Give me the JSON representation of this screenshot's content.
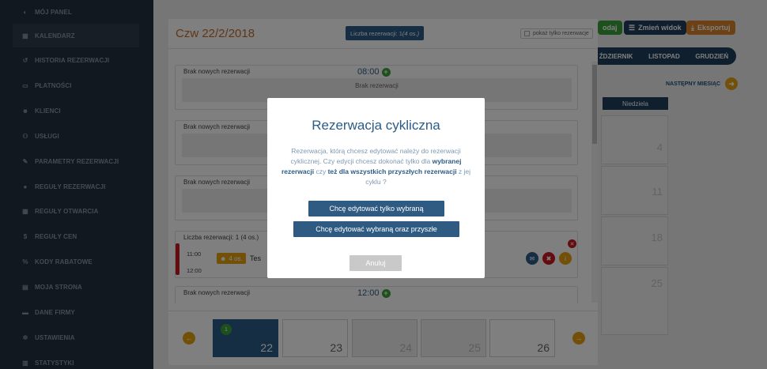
{
  "sidebar": {
    "items": [
      {
        "label": "MÓJ PANEL",
        "icon": "dashboard-icon",
        "glyph": "◐"
      },
      {
        "label": "KALENDARZ",
        "icon": "calendar-icon",
        "glyph": "▦"
      },
      {
        "label": "HISTORIA REZERWACJI",
        "icon": "history-icon",
        "glyph": "↺"
      },
      {
        "label": "PŁATNOŚCI",
        "icon": "card-icon",
        "glyph": "▭"
      },
      {
        "label": "KLIENCI",
        "icon": "users-icon",
        "glyph": "☻"
      },
      {
        "label": "USŁUGI",
        "icon": "cars-icon",
        "glyph": "⚇"
      },
      {
        "label": "PARAMETRY REZERWACJI",
        "icon": "wrench-icon",
        "glyph": "✎"
      },
      {
        "label": "REGUŁY REZERWACJI",
        "icon": "rules-icon",
        "glyph": "●"
      },
      {
        "label": "REGUŁY OTWARCIA",
        "icon": "calendar-rules-icon",
        "glyph": "▦"
      },
      {
        "label": "REGUŁY CEN",
        "icon": "dollar-icon",
        "glyph": "$"
      },
      {
        "label": "KODY RABATOWE",
        "icon": "percent-icon",
        "glyph": "%"
      },
      {
        "label": "MOJA STRONA",
        "icon": "page-icon",
        "glyph": "▤"
      },
      {
        "label": "DANE FIRMY",
        "icon": "briefcase-icon",
        "glyph": "▬"
      },
      {
        "label": "USTAWIENIA",
        "icon": "gear-icon",
        "glyph": "✲"
      },
      {
        "label": "STATYSTYKI",
        "icon": "stats-icon",
        "glyph": "▥"
      }
    ]
  },
  "toolbar": {
    "add_label": "odaj",
    "change_view_label": "Zmień widok",
    "export_label": "Eksportuj"
  },
  "months": [
    "ŹDZIERNIK",
    "LISTOPAD",
    "GRUDZIEŃ"
  ],
  "next_month_label": "NASTĘPNY MIESIĄC",
  "weekday_label": "Niedziela",
  "calendar_numbers": [
    "4",
    "11",
    "18",
    "25"
  ],
  "day_panel": {
    "date": "Czw 22/2/2018",
    "reservation_count": "Liczba rezerwacji: 1 ",
    "reservation_count_em": "(4 os.)",
    "only_reservations_label": "pokaż tylko rezerwacje",
    "slots": [
      {
        "label": "Brak nowych rezerwacji",
        "time": "08:00",
        "inner": "Brak rezerwacji"
      },
      {
        "label": "Brak nowych rezerwacji",
        "time": "",
        "inner": ""
      },
      {
        "label": "Brak nowych rezerwacji",
        "time": "",
        "inner": ""
      }
    ],
    "booked_slot": {
      "label": "Liczba rezerwacji: 1 (4 os.)",
      "start": "11:00",
      "end": "12:00",
      "persons": "4 os.",
      "name": "Tes"
    },
    "last_slot": {
      "label": "Brak nowych rezerwacji",
      "time": "12:00"
    },
    "days": [
      {
        "num": "22",
        "badge": "1",
        "state": "active"
      },
      {
        "num": "23",
        "state": "normal"
      },
      {
        "num": "24",
        "state": "disabled"
      },
      {
        "num": "25",
        "state": "disabled"
      },
      {
        "num": "26",
        "state": "normal"
      }
    ]
  },
  "modal": {
    "title": "Rezerwacja cykliczna",
    "text_1": "Rezerwacja, którą chcesz edytować należy do rezerwacji cyklicznej. Czy edycji chcesz dokonać tylko dla ",
    "text_bold_1": "wybranej rezerwacji",
    "text_2": " czy ",
    "text_bold_2": "też dla wszystkich przyszłych rezerwacji",
    "text_3": " z jej cyklu ?",
    "btn_only_selected": "Chcę edytować tylko wybraną",
    "btn_selected_and_future": "Chcę edytować wybraną oraz przyszłe",
    "btn_cancel": "Anuluj"
  },
  "colors": {
    "sidebar_bg": "#24313e",
    "primary": "#2c5c86",
    "accent_orange": "#e6a10f",
    "danger": "#c9191e",
    "success": "#3aa03a"
  }
}
